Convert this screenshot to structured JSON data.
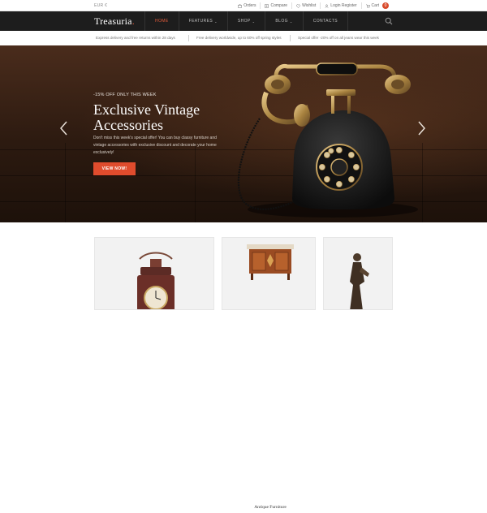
{
  "topbar": {
    "currency": "EUR €",
    "links": [
      {
        "label": "Orders",
        "icon": "box-icon"
      },
      {
        "label": "Compare",
        "icon": "compare-icon"
      },
      {
        "label": "Wishlist",
        "icon": "heart-icon"
      },
      {
        "label": "Login Register",
        "icon": "user-icon"
      },
      {
        "label": "Cart",
        "icon": "cart-icon"
      }
    ],
    "cart_count": "0"
  },
  "nav": {
    "logo": "Treasuria",
    "logo_dot": ".",
    "items": [
      {
        "label": "HOME",
        "active": true,
        "dropdown": false
      },
      {
        "label": "FEATURES",
        "active": false,
        "dropdown": true
      },
      {
        "label": "SHOP",
        "active": false,
        "dropdown": true
      },
      {
        "label": "BLOG",
        "active": false,
        "dropdown": true
      },
      {
        "label": "CONTACTS",
        "active": false,
        "dropdown": false
      }
    ],
    "chevron": "⌄"
  },
  "promo": [
    "Express delivery and free returns within 28 days",
    "Free delivery worldwide, up to 60% off spring styles",
    "Special offer -20% off on all jeans wear this week"
  ],
  "hero": {
    "badge": "-15% OFF ONLY THIS WEEK",
    "title": "Exclusive Vintage Accessories",
    "description": "Don't miss this week's special offer! You can buy classy furniture and vintage accessories with exclusive discount and decorate your home exclusively!",
    "button": "VIEW NOW!"
  },
  "cards": [
    {
      "label": ""
    },
    {
      "label": "Antique Furniture"
    },
    {
      "label": ""
    }
  ],
  "colors": {
    "accent": "#e04c2d",
    "nav_bg": "#1d1d1d",
    "hero_bg": "#3a2216"
  }
}
